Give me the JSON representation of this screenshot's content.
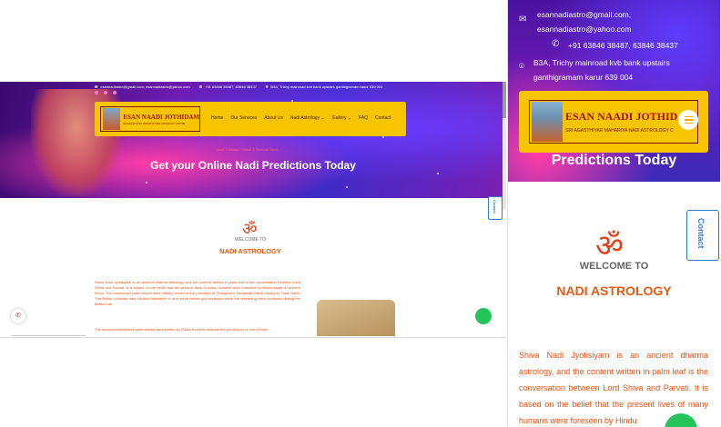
{
  "desktop": {
    "topbar": {
      "email": "esannadiastro@gmail.com, esannadiastro@yahoo.com",
      "phone": "+91 63846 38487, 63846 38437",
      "address": "B3A, Trichy mainroad kvb bank upstairs ganthigramam karur 639 004"
    },
    "logo": {
      "title": "ESAN NAADI JOTHIDAM",
      "subtitle": "SRI AGASTHIYAR MAHARIYA NADI ASTROLOGY CENTRE"
    },
    "menu": [
      "Home",
      "Our Services",
      "About Us",
      "Nadi Astrology ⌄",
      "Gallery ⌄",
      "FAQ",
      "Contact"
    ],
    "hero": {
      "subtitle": "Nadi Jothidam Online & Remote Nadi",
      "title": "Get your Online Nadi Predictions Today"
    },
    "contact_tab": "Contact",
    "welcome": "WELCOME TO",
    "section_title": "NADI ASTROLOGY",
    "paragraph": "Shiva Nadi Jyotisiyam is an ancient dharma astrology and the content written in palm leaf is the conversation between Lord Shiva and Parvati. It is based on the belief that the present lives of many humans were foreseen by Hindu sages in ancient times. The manuscript palm leaves were initially stored in the premises of Thanjavur's Saraswati Mahal Library in Tamil Nadu. The British colonials later showed interest in it, and some leaves got destroyed while the remaining were auctioned during the British rule.",
    "paragraph2": "The ancient manuscripts palm leaves were written by Rishis that tells indicate the predictions of one's future"
  },
  "mobile": {
    "email_line1": "esannadiastro@gmail.com,",
    "email_line2": "esannadiastro@yahoo.com",
    "phone": "+91 63846 38487, 63846 38437",
    "address_line1": "B3A, Trichy mainroad kvb bank upstairs",
    "address_line2": "ganthigramam karur 639 004",
    "logo": {
      "title": "ESAN NAADI JOTHIDAM",
      "subtitle": "SRI AGASTHIYAR MAHARIYA NADI ASTROLOGY C"
    },
    "hero_title": "Predictions Today",
    "contact_tab": "Contact",
    "welcome": "WELCOME TO",
    "section_title": "NADI ASTROLOGY",
    "paragraph": "Shiva Nadi Jyotisiyam is an ancient dharma astrology, and the content written in palm leaf is the conversation between Lord Shiva and Parvati. It is based on the belief that the present lives of many humans were foreseen by Hindu"
  },
  "icons": {
    "email": "envelope-icon",
    "phone": "phone-icon",
    "location": "map-pin-icon",
    "om": "om-symbol-icon",
    "whatsapp": "whatsapp-icon",
    "menu": "hamburger-icon"
  },
  "colors": {
    "nav_yellow": "#f7c400",
    "accent_orange": "#e65a12",
    "hero_purple": "#6a1bb5",
    "contact_blue": "#2b7cd3",
    "whatsapp_green": "#25c45a"
  }
}
